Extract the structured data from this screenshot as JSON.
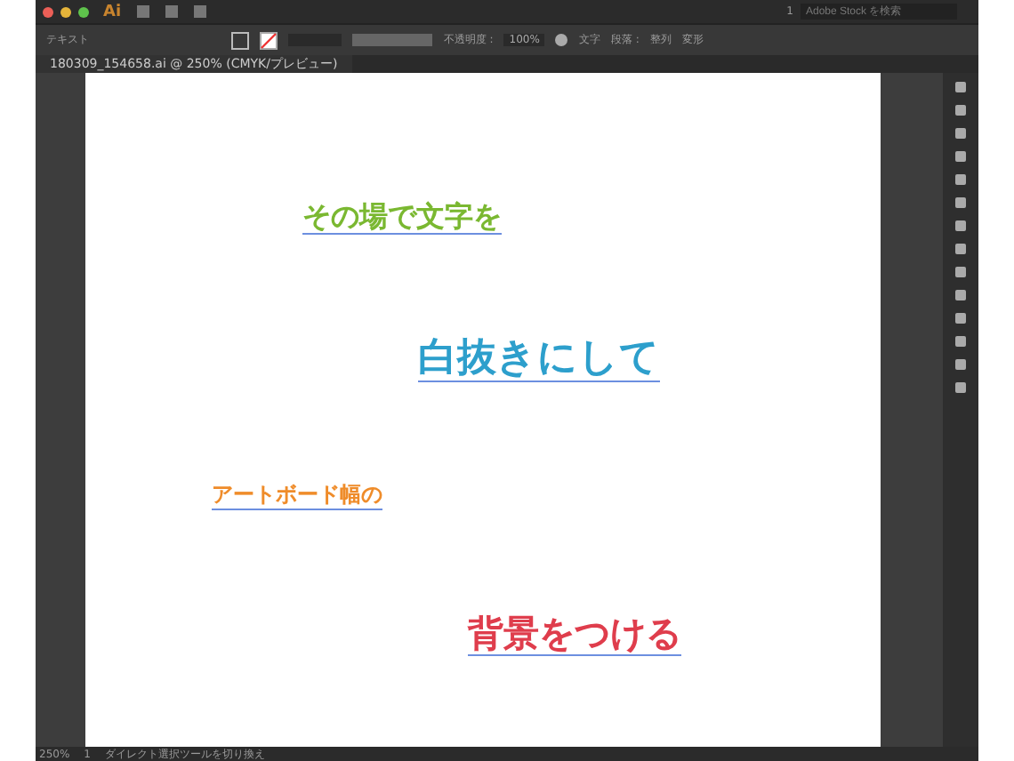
{
  "app": {
    "logo": "Ai",
    "search": {
      "placeholder": "Adobe Stock を検索"
    },
    "workspace": "1"
  },
  "control_bar": {
    "tool": "テキスト",
    "opacity_label": "不透明度 :",
    "opacity": "100%",
    "items": [
      "文字",
      "段落 :",
      "整列",
      "変形"
    ]
  },
  "tabs": [
    {
      "label": "180309_154658.ai @ 250% (CMYK/プレビュー)",
      "selected": true
    }
  ],
  "artboard": {
    "texts": [
      {
        "text": "その場で文字を",
        "color": "#7ab831"
      },
      {
        "text": "白抜きにして",
        "color": "#2d9fcc"
      },
      {
        "text": "アートボード幅の",
        "color": "#ef8c2a"
      },
      {
        "text": "背景をつける",
        "color": "#df3d4c"
      }
    ]
  },
  "status_bar": {
    "zoom": "250%",
    "page": "1",
    "message": "ダイレクト選択ツールを切り換え"
  }
}
